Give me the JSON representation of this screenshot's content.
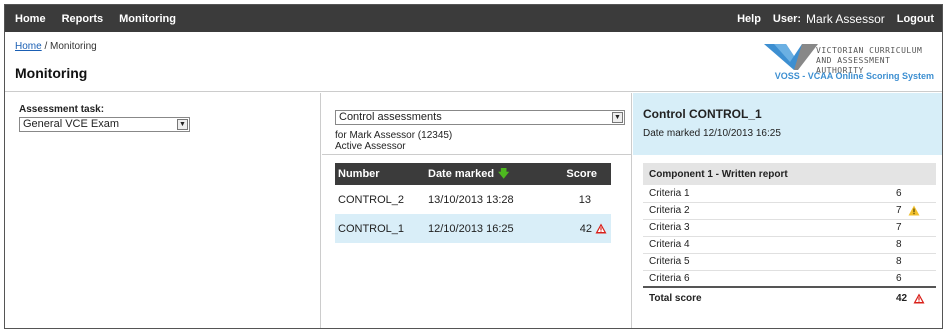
{
  "nav": {
    "left": [
      "Home",
      "Reports",
      "Monitoring"
    ],
    "help": "Help",
    "user_label": "User:",
    "user_name": "Mark Assessor",
    "logout": "Logout"
  },
  "breadcrumb": {
    "home": "Home",
    "sep": " / ",
    "current": "Monitoring"
  },
  "page_title": "Monitoring",
  "logo": {
    "line1": "VICTORIAN CURRICULUM",
    "line2": "AND ASSESSMENT AUTHORITY",
    "sub": "VOSS - VCAA Online Scoring System"
  },
  "assessment_task": {
    "label": "Assessment task:",
    "value": "General VCE Exam"
  },
  "middle": {
    "select_value": "Control assessments",
    "for_line": "for  Mark Assessor (12345)",
    "status": "Active Assessor",
    "columns": [
      "Number",
      "Date marked",
      "Score"
    ],
    "rows": [
      {
        "number": "CONTROL_2",
        "date": "13/10/2013 13:28",
        "score": "13",
        "selected": false,
        "warning": false
      },
      {
        "number": "CONTROL_1",
        "date": "12/10/2013 16:25",
        "score": "42",
        "selected": true,
        "warning": true
      }
    ]
  },
  "detail": {
    "title": "Control CONTROL_1",
    "date_marked": "Date marked 12/10/2013 16:25",
    "component": "Component 1 - Written report",
    "criteria": [
      {
        "name": "Criteria 1",
        "score": "6",
        "warning": ""
      },
      {
        "name": "Criteria 2",
        "score": "7",
        "warning": "yellow"
      },
      {
        "name": "Criteria 3",
        "score": "7",
        "warning": ""
      },
      {
        "name": "Criteria 4",
        "score": "8",
        "warning": ""
      },
      {
        "name": "Criteria 5",
        "score": "8",
        "warning": ""
      },
      {
        "name": "Criteria 6",
        "score": "6",
        "warning": ""
      }
    ],
    "total_label": "Total score",
    "total_value": "42",
    "total_warning": "red"
  },
  "colors": {
    "nav_bg": "#3b3b3b",
    "selected_row": "#d9eef8",
    "panel_bg": "#d7eef8",
    "warn_red": "#d9201a",
    "warn_yellow": "#f2c12e",
    "sort_green": "#4db81f"
  }
}
